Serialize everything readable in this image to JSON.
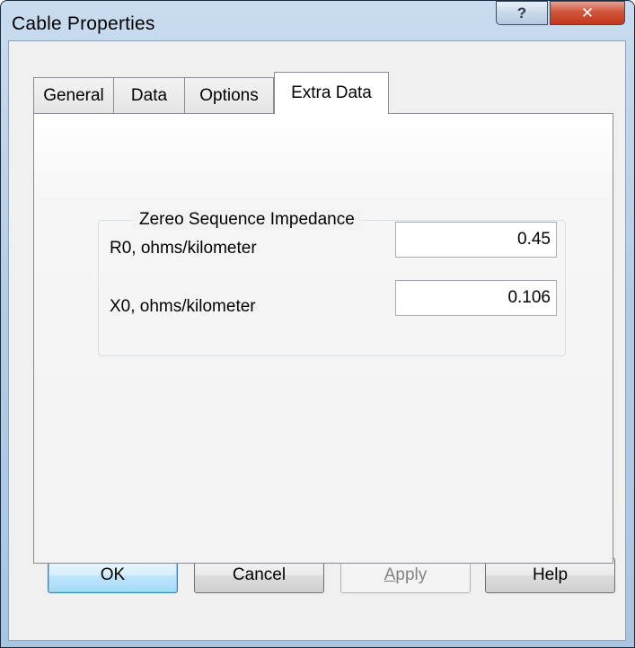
{
  "window": {
    "title": "Cable Properties",
    "help_glyph": "?",
    "close_glyph": "✕"
  },
  "tabs": [
    {
      "label": "General",
      "active": false
    },
    {
      "label": "Data",
      "active": false
    },
    {
      "label": "Options",
      "active": false
    },
    {
      "label": "Extra Data",
      "active": true
    }
  ],
  "group": {
    "title": "Zereo Sequence Impedance",
    "fields": [
      {
        "label": "R0, ohms/kilometer",
        "value": "0.45"
      },
      {
        "label": "X0, ohms/kilometer",
        "value": "0.106"
      }
    ]
  },
  "buttons": {
    "ok": "OK",
    "cancel": "Cancel",
    "apply_mnemonic": "A",
    "apply_rest": "pply",
    "help": "Help"
  },
  "colors": {
    "frame": "#b4cde6",
    "close_button": "#c0391d",
    "default_button": "#3c7fb1"
  }
}
